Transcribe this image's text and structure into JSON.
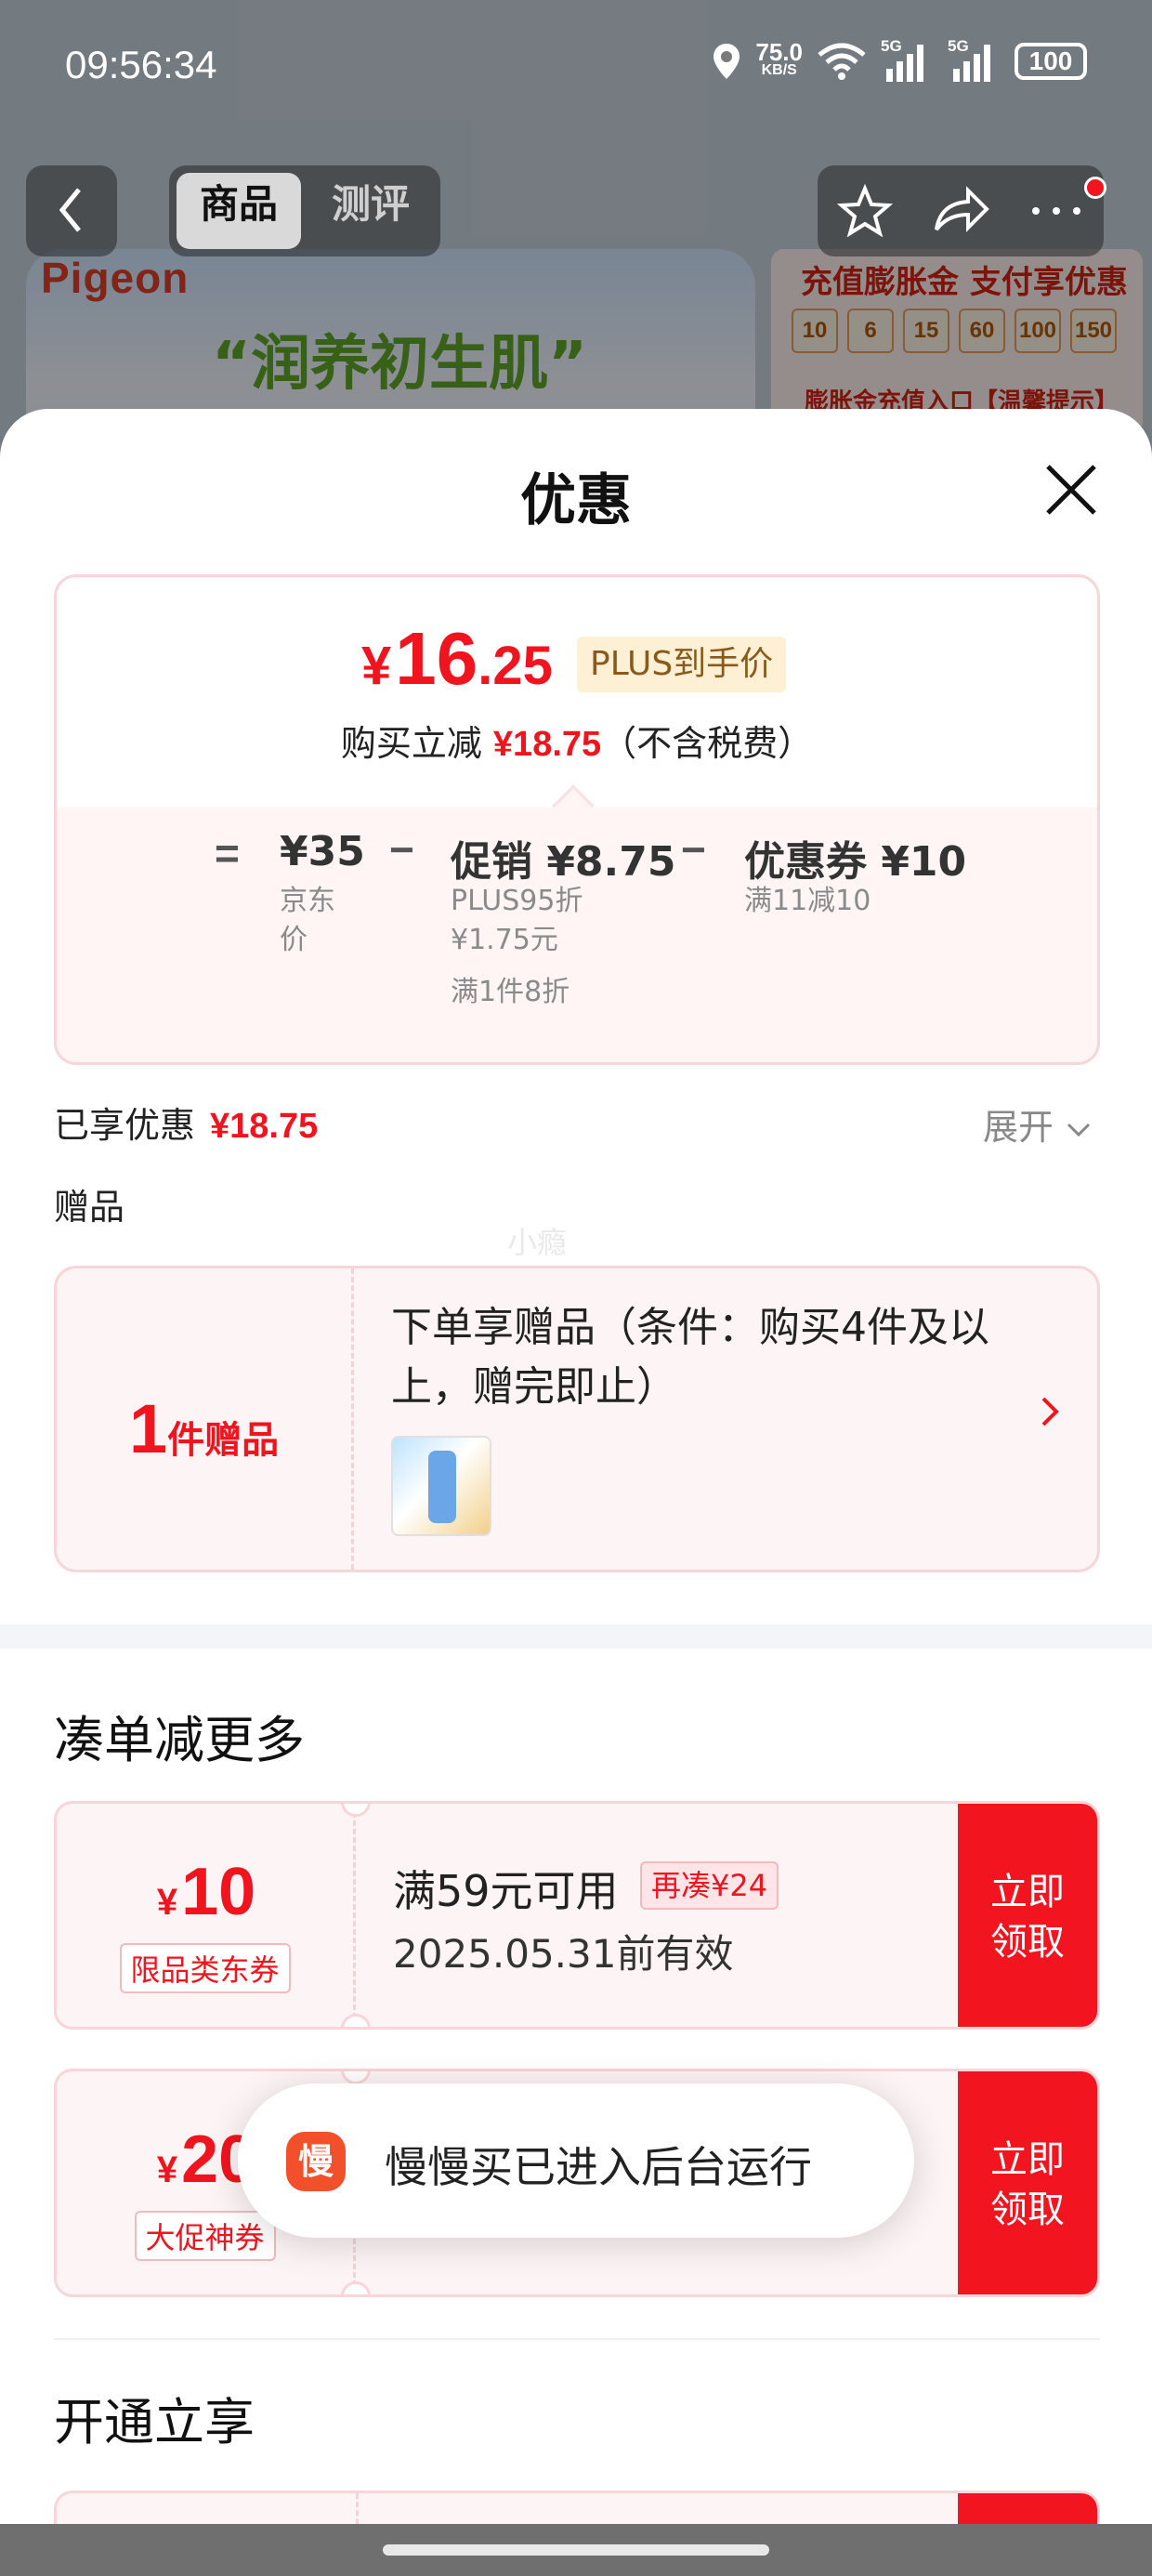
{
  "status_bar": {
    "time": "09:56:34",
    "speed_value": "75.0",
    "speed_unit": "KB/S",
    "signal_label_1": "5G",
    "signal_label_2": "5G",
    "battery": "100"
  },
  "nav": {
    "tabs": [
      {
        "label": "商品",
        "active": true
      },
      {
        "label": "测评",
        "active": false
      }
    ]
  },
  "background": {
    "brand": "Pigeon",
    "slogan": "“润养初生肌”",
    "promo_title": "充值膨胀金 支付享优惠",
    "promo_chips": [
      "10",
      "6",
      "15",
      "60",
      "100",
      "150"
    ],
    "promo_sub": "膨胀金充值入口【温馨提示】"
  },
  "sheet": {
    "title": "优惠",
    "price_card": {
      "currency": "¥",
      "price_int": "16",
      "price_dec": ".25",
      "plus_tag": "PLUS到手价",
      "save_prefix": "购买立减",
      "save_amount": "¥18.75",
      "save_suffix": "（不含税费）",
      "formula": {
        "equals": "=",
        "minus": "−",
        "base_amount": "¥35",
        "base_label_1": "京东",
        "base_label_2": "价",
        "promo_amount": "促销 ¥8.75",
        "promo_detail_1": "PLUS95折",
        "promo_detail_2": "¥1.75元",
        "promo_detail_3": "满1件8折",
        "coupon_amount": "优惠券 ¥10",
        "coupon_detail": "满11减10"
      }
    },
    "enjoyed_label": "已享优惠",
    "enjoyed_amount": "¥18.75",
    "expand_label": "展开",
    "gift_label": "赠品",
    "watermark": "小瘾",
    "gift_card": {
      "count": "1",
      "count_unit": "件赠品",
      "description": "下单享赠品（条件：购买4件及以上，赠完即止）"
    },
    "more_title": "凑单减更多",
    "coupons": [
      {
        "currency": "¥",
        "amount": "10",
        "type": "限品类东券",
        "condition": "满59元可用",
        "tag": "再凑¥24",
        "validity": "2025.05.31前有效",
        "button_line1": "立即",
        "button_line2": "领取"
      },
      {
        "currency": "¥",
        "amount": "20",
        "type": "大促神券",
        "condition": "",
        "tag": "",
        "validity": "",
        "button_line1": "立即",
        "button_line2": "领取"
      }
    ],
    "open_title": "开通立享"
  },
  "toast": {
    "icon_char": "慢",
    "text": "慢慢买已进入后台运行"
  },
  "colors": {
    "accent_red": "#f0141e",
    "plus_tag_bg": "#fdf0d4",
    "card_border": "#f8d5d8"
  }
}
